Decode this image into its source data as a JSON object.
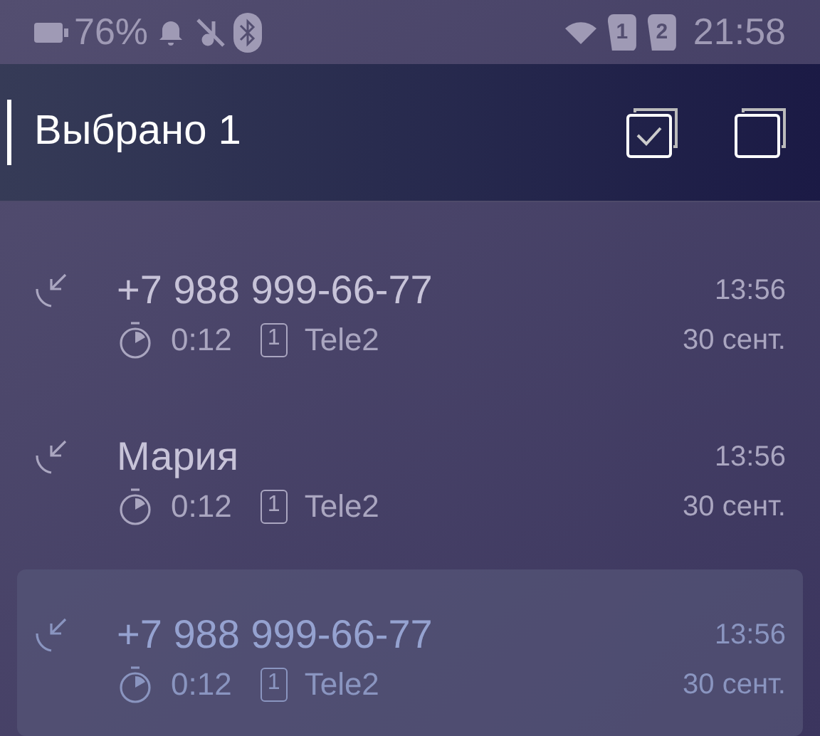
{
  "status_bar": {
    "battery": "76%",
    "sims": [
      "1",
      "2"
    ],
    "time": "21:58"
  },
  "header": {
    "title": "Выбрано 1"
  },
  "calls": [
    {
      "name": "+7 988 999-66-77",
      "duration": "0:12",
      "sim": "1",
      "carrier": "Tele2",
      "time": "13:56",
      "date": "30 сент.",
      "selected": false
    },
    {
      "name": "Мария",
      "duration": "0:12",
      "sim": "1",
      "carrier": "Tele2",
      "time": "13:56",
      "date": "30 сент.",
      "selected": false
    },
    {
      "name": "+7 988 999-66-77",
      "duration": "0:12",
      "sim": "1",
      "carrier": "Tele2",
      "time": "13:56",
      "date": "30 сент.",
      "selected": true
    }
  ]
}
